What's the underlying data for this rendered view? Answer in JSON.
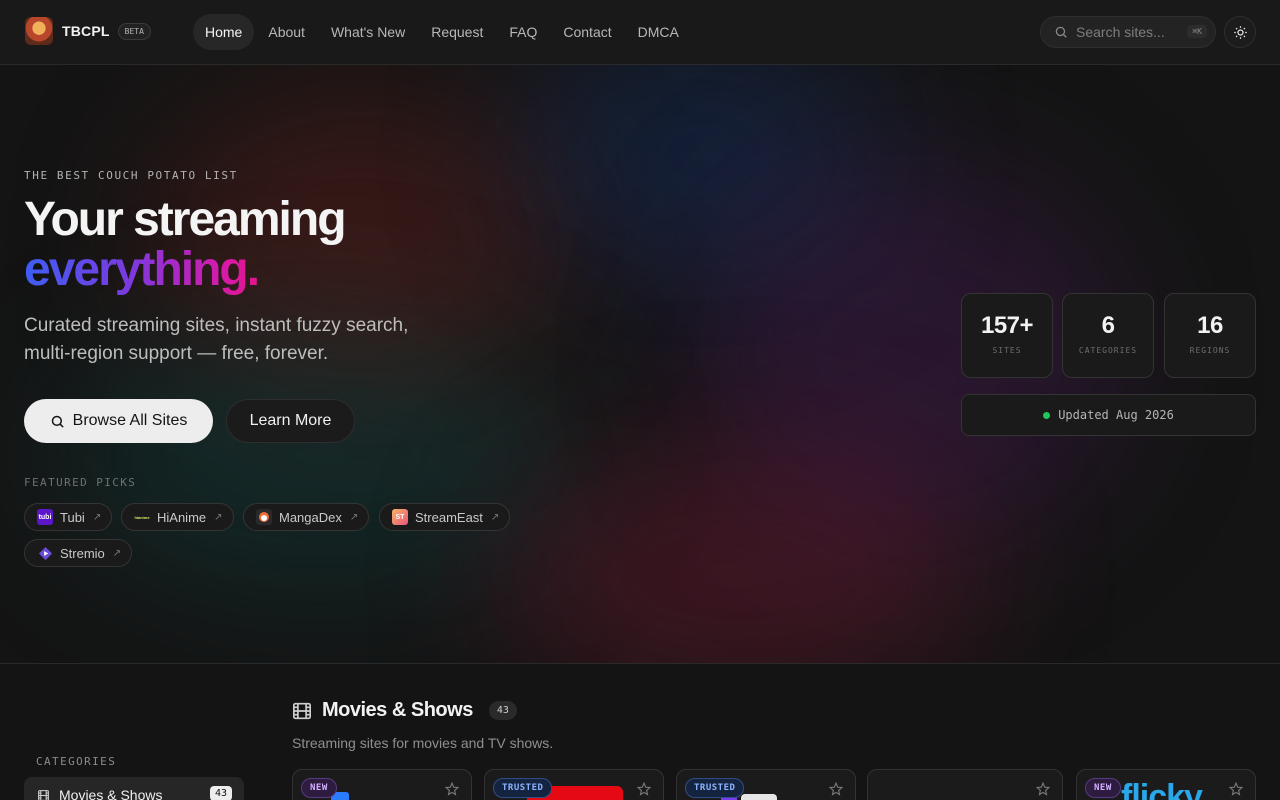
{
  "nav": {
    "brand": "TBCPL",
    "badge": "BETA",
    "links": [
      "Home",
      "About",
      "What's New",
      "Request",
      "FAQ",
      "Contact",
      "DMCA"
    ],
    "search_placeholder": "Search sites...",
    "shortcut": "⌘K"
  },
  "hero": {
    "eyebrow": "THE BEST COUCH POTATO LIST",
    "title_line1": "Your streaming",
    "title_line2": "everything.",
    "subtitle": "Curated streaming sites, instant fuzzy search, multi-region support — free, forever.",
    "browse_label": "Browse All Sites",
    "learn_label": "Learn More",
    "featured_label": "FEATURED PICKS",
    "featured": [
      {
        "name": "Tubi",
        "icon": "tubi-icon",
        "color": "#5b16c9",
        "mark": "tubi"
      },
      {
        "name": "HiAnime",
        "icon": "hianime-icon",
        "color": "#1a1a1a",
        "mark": "hianime"
      },
      {
        "name": "MangaDex",
        "icon": "mangadex-icon",
        "color": "#f26c3a",
        "mark": ""
      },
      {
        "name": "StreamEast",
        "icon": "streameast-icon",
        "color": "#f08a5d",
        "mark": "ST"
      },
      {
        "name": "Stremio",
        "icon": "stremio-icon",
        "color": "#6a4bdc",
        "mark": ""
      }
    ],
    "stats": [
      {
        "value": "157+",
        "label": "SITES"
      },
      {
        "value": "6",
        "label": "CATEGORIES"
      },
      {
        "value": "16",
        "label": "REGIONS"
      }
    ],
    "updated": "Updated Aug 2026"
  },
  "sidebar": {
    "label": "CATEGORIES",
    "active_item": {
      "name": "Movies & Shows",
      "count": "43"
    }
  },
  "section": {
    "title": "Movies & Shows",
    "count": "43",
    "subtitle": "Streaming sites for movies and TV shows.",
    "cards": [
      {
        "badge": "NEW",
        "badge_type": "new",
        "logo": "",
        "logo_color": "#2a7bff"
      },
      {
        "badge": "TRUSTED",
        "badge_type": "trusted",
        "logo": "",
        "logo_color": "#e50914"
      },
      {
        "badge": "TRUSTED",
        "badge_type": "trusted",
        "logo": "",
        "logo_color": "#7a3cf0"
      },
      {
        "badge": "",
        "badge_type": "",
        "logo": "",
        "logo_color": "#333333"
      },
      {
        "badge": "NEW",
        "badge_type": "new",
        "logo": "flicky",
        "logo_color": "#2aa7e8"
      }
    ]
  }
}
